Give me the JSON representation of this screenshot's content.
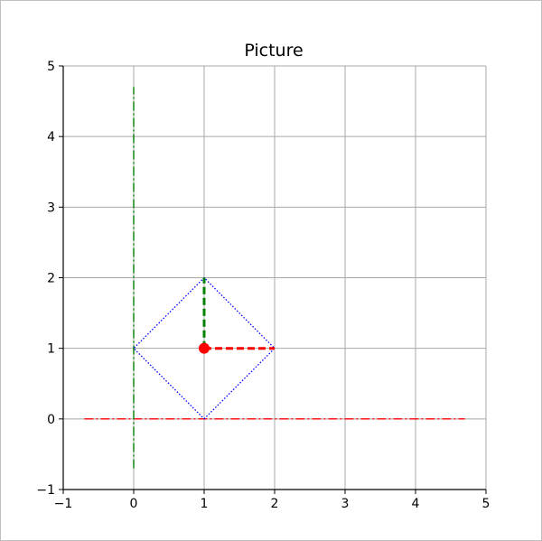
{
  "chart_data": {
    "type": "line",
    "title": "Picture",
    "xlabel": "",
    "ylabel": "",
    "xlim": [
      -1,
      5
    ],
    "ylim": [
      -1,
      5
    ],
    "x_ticks": [
      -1,
      0,
      1,
      2,
      3,
      4,
      5
    ],
    "y_ticks": [
      -1,
      0,
      1,
      2,
      3,
      4,
      5
    ],
    "x_tick_labels": [
      "−1",
      "0",
      "1",
      "2",
      "3",
      "4",
      "5"
    ],
    "y_tick_labels": [
      "−1",
      "0",
      "1",
      "2",
      "3",
      "4",
      "5"
    ],
    "grid": true,
    "series": [
      {
        "style": "dashdot",
        "color": "#ff0000",
        "x": [
          -0.7,
          4.7
        ],
        "y": [
          0,
          0
        ]
      },
      {
        "style": "dashdot",
        "color": "#008000",
        "x": [
          0,
          0
        ],
        "y": [
          -0.7,
          4.7
        ]
      },
      {
        "style": "dotted",
        "color": "#0000ff",
        "x": [
          1,
          2,
          1,
          0,
          1
        ],
        "y": [
          0,
          1,
          2,
          1,
          0
        ]
      },
      {
        "style": "dashed",
        "color": "#ff0000",
        "x": [
          1,
          2
        ],
        "y": [
          1,
          1
        ]
      },
      {
        "style": "dashed",
        "color": "#008000",
        "x": [
          1,
          1
        ],
        "y": [
          1,
          2
        ]
      }
    ],
    "points": [
      {
        "x": 1,
        "y": 1,
        "color": "#ff0000",
        "marker": "circle"
      }
    ]
  }
}
